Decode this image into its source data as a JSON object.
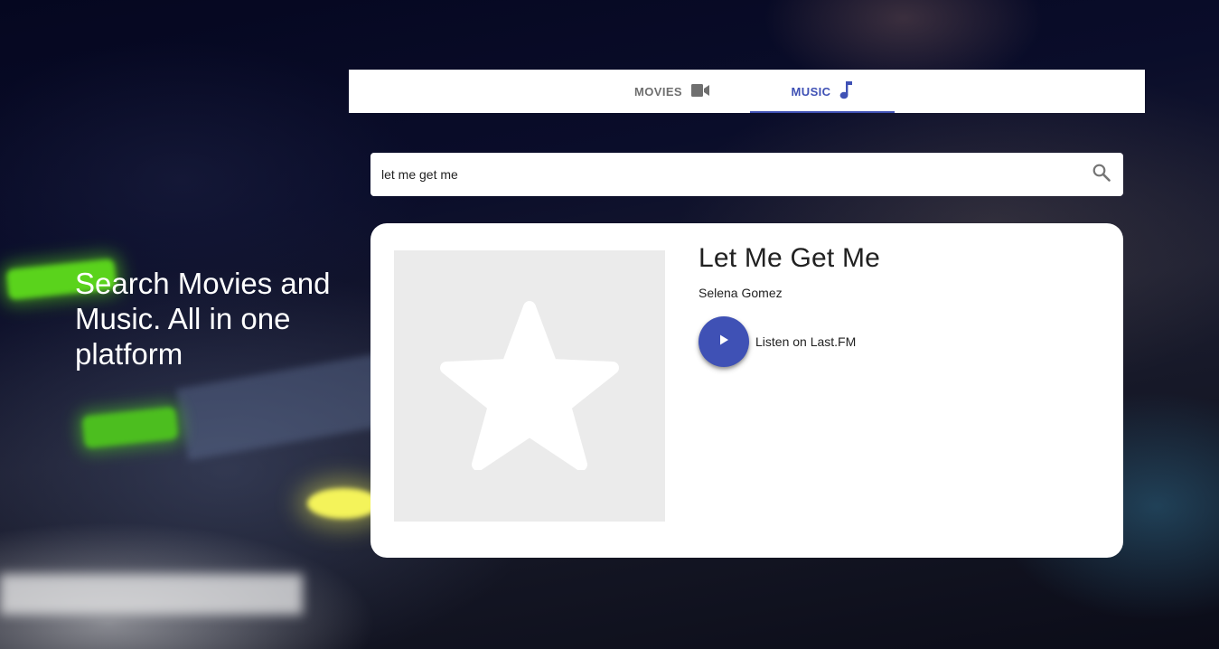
{
  "hero": {
    "text": "Search Movies and Music. All in one platform"
  },
  "tabs": [
    {
      "label": "MOVIES",
      "icon": "video-camera-icon",
      "active": false
    },
    {
      "label": "MUSIC",
      "icon": "music-note-icon",
      "active": true
    }
  ],
  "search": {
    "value": "let me get me",
    "icon": "search-icon"
  },
  "result": {
    "title": "Let Me Get Me",
    "artist": "Selena Gomez",
    "cover_icon": "star-icon",
    "play_icon": "play-icon",
    "listen_label": "Listen on Last.FM"
  },
  "colors": {
    "accent": "#3f51b5",
    "tab_inactive": "#6f6f6f",
    "cover_placeholder": "#ebebeb"
  }
}
